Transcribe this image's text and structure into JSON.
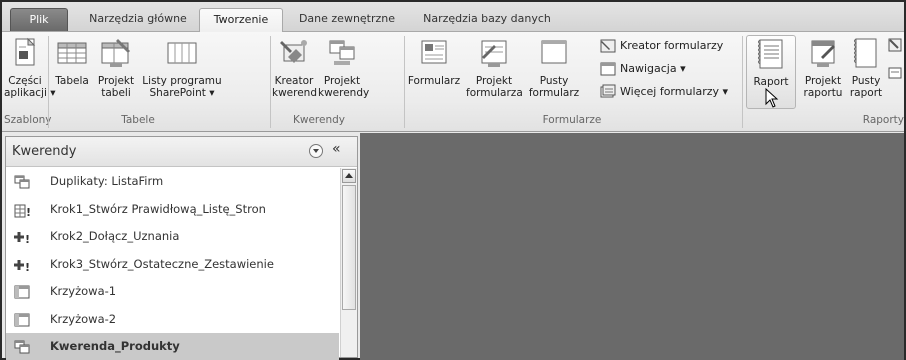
{
  "tabs": [
    {
      "label": "Plik",
      "type": "file"
    },
    {
      "label": "Narzędzia główne",
      "type": "normal"
    },
    {
      "label": "Tworzenie",
      "type": "active"
    },
    {
      "label": "Dane zewnętrzne",
      "type": "normal"
    },
    {
      "label": "Narzędzia bazy danych",
      "type": "normal"
    }
  ],
  "ribbon": {
    "groups": {
      "szablony": "Szablony",
      "tabele": "Tabele",
      "kwerendy": "Kwerendy",
      "formularze": "Formularze",
      "raporty": "Raporty"
    },
    "buttons": {
      "czesci_1": "Części",
      "czesci_2": "aplikacji ▾",
      "tabela": "Tabela",
      "projekt_tabeli_1": "Projekt",
      "projekt_tabeli_2": "tabeli",
      "listy_1": "Listy programu",
      "listy_2": "SharePoint ▾",
      "kreator_kw_1": "Kreator",
      "kreator_kw_2": "kwerend",
      "projekt_kw_1": "Projekt",
      "projekt_kw_2": "kwerendy",
      "formularz": "Formularz",
      "projekt_form_1": "Projekt",
      "projekt_form_2": "formularza",
      "pusty_form_1": "Pusty",
      "pusty_form_2": "formularz",
      "kreator_formularzy": "Kreator formularzy",
      "nawigacja": "Nawigacja ▾",
      "wiecej_formularzy": "Więcej formularzy ▾",
      "raport": "Raport",
      "projekt_raportu_1": "Projekt",
      "projekt_raportu_2": "raportu",
      "pusty_raport_1": "Pusty",
      "pusty_raport_2": "raport"
    }
  },
  "nav": {
    "title": "Kwerendy",
    "collapse": "«",
    "items": [
      {
        "label": "Duplikaty: ListaFirm",
        "icon": "select-query-icon",
        "selected": false
      },
      {
        "label": "Krok1_Stwórz Prawidłową_Listę_Stron",
        "icon": "make-table-query-icon",
        "selected": false
      },
      {
        "label": "Krok2_Dołącz_Uznania",
        "icon": "append-query-icon",
        "selected": false
      },
      {
        "label": "Krok3_Stwórz_Ostateczne_Zestawienie",
        "icon": "append-query-icon",
        "selected": false
      },
      {
        "label": "Krzyżowa-1",
        "icon": "crosstab-query-icon",
        "selected": false
      },
      {
        "label": "Krzyżowa-2",
        "icon": "crosstab-query-icon",
        "selected": false
      },
      {
        "label": "Kwerenda_Produkty",
        "icon": "select-query-icon",
        "selected": true
      }
    ]
  }
}
